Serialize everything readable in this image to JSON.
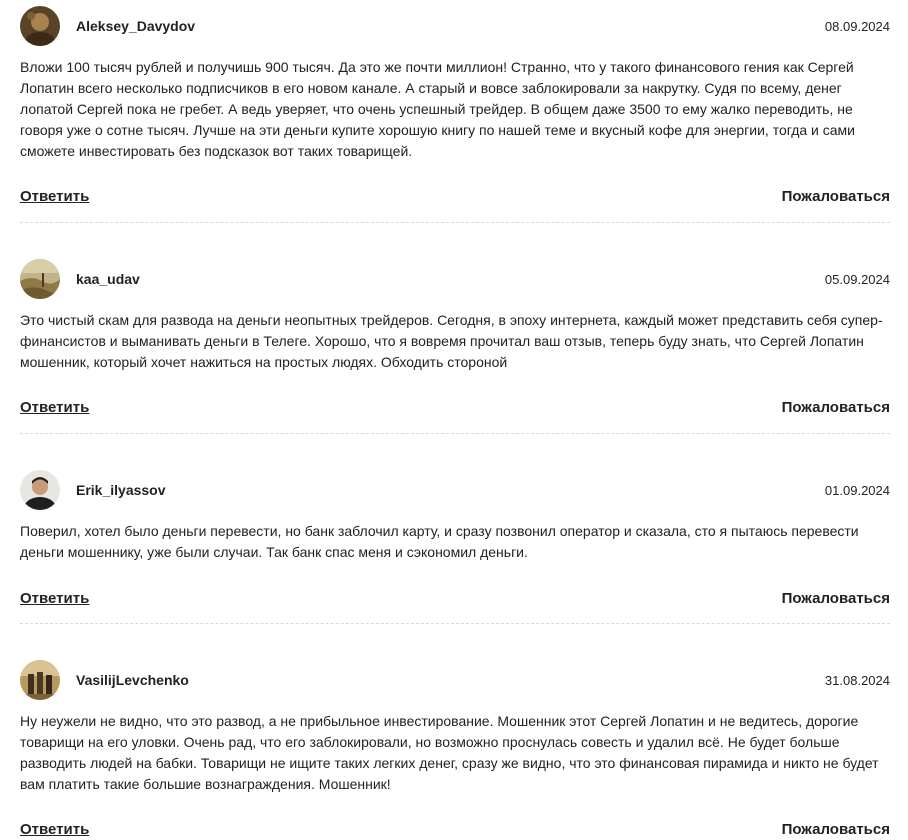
{
  "comments": [
    {
      "username": "Aleksey_Davydov",
      "date": "08.09.2024",
      "text": "Вложи 100 тысяч рублей и получишь 900 тысяч. Да это же почти миллион! Странно, что у такого финансового гения как Сергей Лопатин всего несколько подписчиков в его новом канале. А старый и вовсе заблокировали за накрутку. Судя по всему, денег лопатой Сергей пока не гребет. А ведь уверяет, что очень успешный трейдер. В общем даже 3500 то ему жалко переводить, не говоря уже о сотне тысяч. Лучше на эти деньги купите хорошую книгу по нашей теме и вкусный кофе для энергии, тогда и сами сможете инвестировать без подсказок вот таких товарищей.",
      "reply_label": "Ответить",
      "report_label": "Пожаловаться"
    },
    {
      "username": "kaa_udav",
      "date": "05.09.2024",
      "text": "Это чистый скам для развода на деньги неопытных трейдеров. Сегодня, в эпоху интернета, каждый может представить себя супер-финансистов и выманивать деньги в Телеге. Хорошо, что я вовремя прочитал ваш отзыв, теперь буду знать, что Сергей Лопатин мошенник, который хочет нажиться на простых людях. Обходить стороной",
      "reply_label": "Ответить",
      "report_label": "Пожаловаться"
    },
    {
      "username": "Erik_ilyassov",
      "date": "01.09.2024",
      "text": "Поверил, хотел было деньги перевести, но банк заблочил карту, и сразу позвонил оператор и сказала, сто я пытаюсь перевести деньги мошеннику, уже были случаи. Так банк спас меня и сэкономил деньги.",
      "reply_label": "Ответить",
      "report_label": "Пожаловаться"
    },
    {
      "username": "VasilijLevchenko",
      "date": "31.08.2024",
      "text": "Ну неужели не видно, что это развод, а не прибыльное инвестирование. Мошенник этот Сергей Лопатин и не ведитесь, дорогие товарищи на его уловки. Очень рад, что его заблокировали, но возможно проснулась совесть и удалил всё. Не будет больше разводить людей на бабки. Товарищи не ищите таких легких денег, сразу же видно, что это финансовая пирамида и никто не будет вам платить такие большие вознаграждения. Мошенник!",
      "reply_label": "Ответить",
      "report_label": "Пожаловаться"
    }
  ]
}
